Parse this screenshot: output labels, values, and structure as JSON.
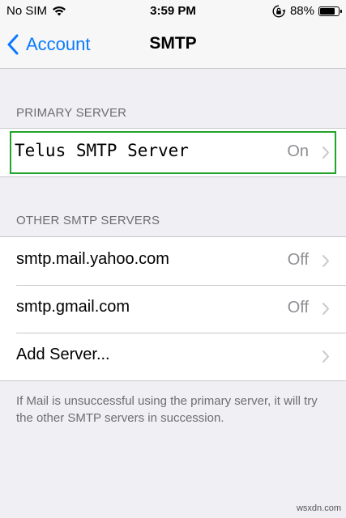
{
  "status_bar": {
    "carrier": "No SIM",
    "time": "3:59 PM",
    "battery": "88%",
    "battery_level": 0.88,
    "icons": [
      "wifi-icon",
      "orientation-lock-icon",
      "battery-icon"
    ]
  },
  "nav": {
    "back_label": "Account",
    "title": "SMTP"
  },
  "primary": {
    "header": "PRIMARY SERVER",
    "server_name": "Telus SMTP Server",
    "server_status": "On"
  },
  "other": {
    "header": "OTHER SMTP SERVERS",
    "servers": [
      {
        "name": "smtp.mail.yahoo.com",
        "status": "Off"
      },
      {
        "name": "smtp.gmail.com",
        "status": "Off"
      }
    ],
    "add_label": "Add Server..."
  },
  "footer": {
    "note": "If Mail is unsuccessful using the primary server, it will try the other SMTP servers in succession."
  },
  "watermark": "wsxdn.com",
  "colors": {
    "accent": "#0a7aff",
    "highlight": "#22a32a",
    "background": "#efeff4"
  }
}
